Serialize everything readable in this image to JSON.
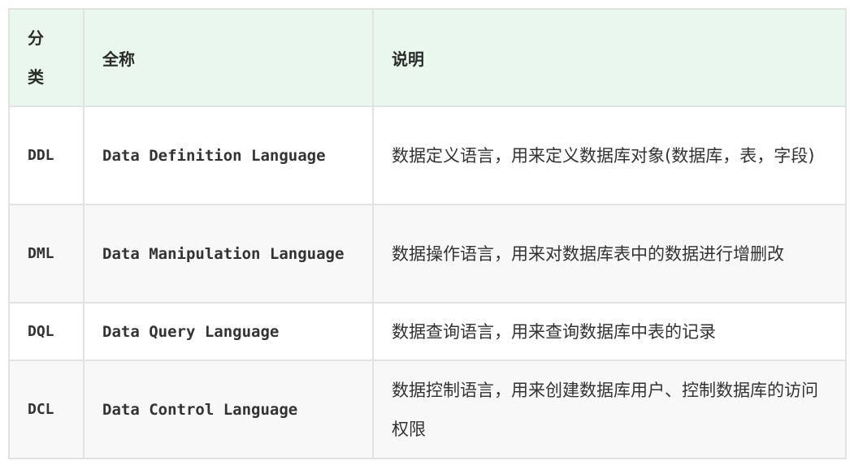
{
  "table": {
    "headers": {
      "category": "分类",
      "full_name": "全称",
      "description": "说明"
    },
    "rows": [
      {
        "category": "DDL",
        "full_name": "Data Definition Language",
        "description": "数据定义语言，用来定义数据库对象(数据库，表，字段)"
      },
      {
        "category": "DML",
        "full_name": "Data Manipulation Language",
        "description": "数据操作语言，用来对数据库表中的数据进行增删改"
      },
      {
        "category": "DQL",
        "full_name": "Data Query Language",
        "description": "数据查询语言，用来查询数据库中表的记录"
      },
      {
        "category": "DCL",
        "full_name": "Data Control Language",
        "description": "数据控制语言，用来创建数据库用户、控制数据库的访问权限"
      }
    ]
  }
}
